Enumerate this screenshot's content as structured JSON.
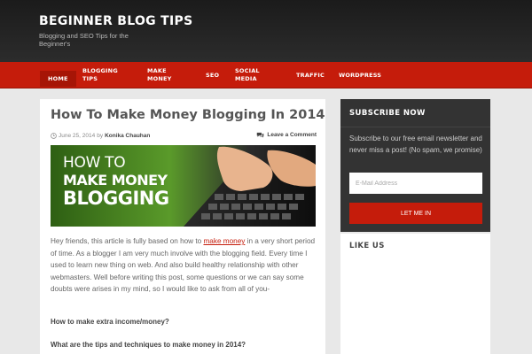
{
  "site": {
    "title": "BEGINNER BLOG TIPS",
    "description": "Blogging and SEO Tips for the Beginner's"
  },
  "nav": {
    "items": [
      {
        "label": "HOME"
      },
      {
        "label": "BLOGGING TIPS"
      },
      {
        "label": "MAKE MONEY"
      },
      {
        "label": "SEO"
      },
      {
        "label": "SOCIAL MEDIA"
      },
      {
        "label": "TRAFFIC"
      },
      {
        "label": "WORDPRESS"
      }
    ]
  },
  "post": {
    "title": "How To Make Money Blogging In 2014",
    "date": "June 25, 2014",
    "by": "by",
    "author": "Konika Chauhan",
    "comment_label": "Leave a Comment",
    "banner": {
      "line1": "HOW TO",
      "line2": "MAKE MONEY",
      "line3": "BLOGGING"
    },
    "intro_before": "Hey friends, this article is fully based on how to ",
    "intro_link": "make money",
    "intro_after": " in a very short period of time. As a blogger I am very much involve with the blogging field. Every time I used to learn new thing on web. And also build healthy relationship with other webmasters. Well before writing this post, some questions or we can say some doubts were arises in my mind, so I would like to ask from all of you-",
    "q1": "How to make extra income/money?",
    "q2": "What are the tips and techniques to make money in 2014?"
  },
  "subscribe": {
    "title": "SUBSCRIBE NOW",
    "text": "Subscribe to our free email newsletter and never miss a post! (No spam, we promise)",
    "email_placeholder": "E-Mail Address",
    "button": "LET ME IN"
  },
  "like_us": {
    "title": "LIKE US"
  },
  "colors": {
    "accent": "#c51c0b",
    "header_bg": "#1b1b1b",
    "sidebar_bg": "#333333"
  }
}
